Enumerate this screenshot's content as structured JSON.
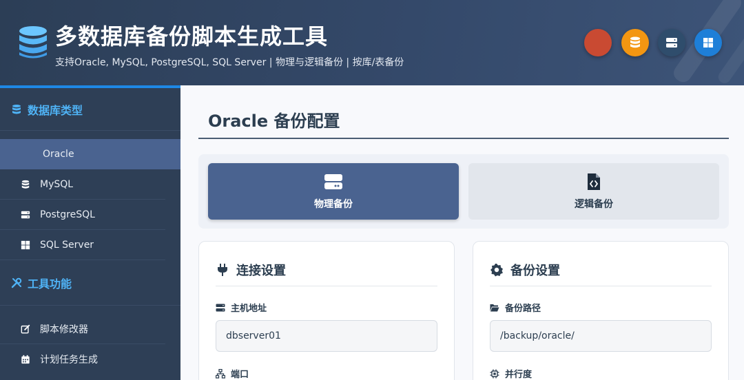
{
  "header": {
    "title": "多数据库备份脚本生成工具",
    "subtitle": "支持Oracle, MySQL, PostgreSQL, SQL Server | 物理与逻辑备份 | 按库/表备份",
    "db_buttons": [
      {
        "name": "oracle",
        "icon": "circle-icon",
        "color": "#c94a32"
      },
      {
        "name": "mysql",
        "icon": "database-icon",
        "color": "#f39612"
      },
      {
        "name": "postgresql",
        "icon": "server-icon",
        "color": "#2f4d6c"
      },
      {
        "name": "sqlserver",
        "icon": "windows-icon",
        "color": "#1e7fd8"
      }
    ]
  },
  "sidebar": {
    "section1": {
      "label": "数据库类型",
      "icon": "database-icon"
    },
    "items": [
      {
        "label": "Oracle",
        "active": true
      },
      {
        "label": "MySQL",
        "icon": "database-icon"
      },
      {
        "label": "PostgreSQL",
        "icon": "server-icon"
      },
      {
        "label": "SQL Server",
        "icon": "windows-icon"
      }
    ],
    "section2": {
      "label": "工具功能",
      "icon": "tools-icon"
    },
    "tools": [
      {
        "label": "脚本修改器",
        "icon": "edit-icon"
      },
      {
        "label": "计划任务生成",
        "icon": "calendar-icon"
      }
    ]
  },
  "main": {
    "title": "Oracle 备份配置",
    "modes": [
      {
        "label": "物理备份",
        "icon": "hdd-icon",
        "active": true
      },
      {
        "label": "逻辑备份",
        "icon": "file-code-icon",
        "active": false
      }
    ],
    "connection": {
      "title": "连接设置",
      "host_label": "主机地址",
      "host_value": "dbserver01",
      "port_label": "端口"
    },
    "backup": {
      "title": "备份设置",
      "path_label": "备份路径",
      "path_value": "/backup/oracle/",
      "parallel_label": "并行度"
    }
  },
  "colors": {
    "accent": "#1e88e5",
    "active_blue": "#4a6390",
    "sidebar_bg": "#2e3f56",
    "section_text": "#4fb3f6"
  }
}
